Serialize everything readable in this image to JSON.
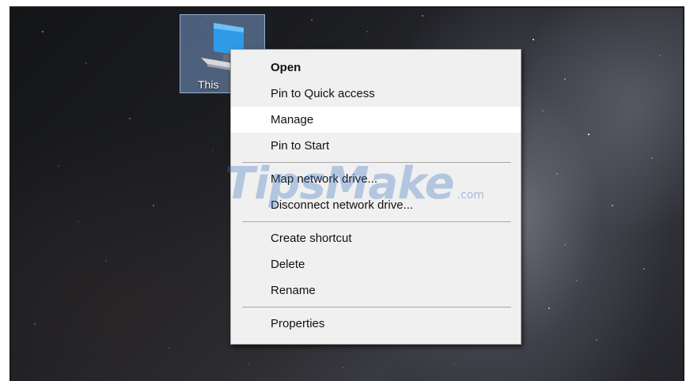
{
  "desktop_icon": {
    "label": "This",
    "icon": "monitor-icon"
  },
  "context_menu": {
    "items": [
      {
        "label": "Open",
        "bold": true
      },
      {
        "label": "Pin to Quick access"
      },
      {
        "label": "Manage",
        "highlighted": true
      },
      {
        "label": "Pin to Start"
      },
      {
        "label": "Map network drive..."
      },
      {
        "label": "Disconnect network drive..."
      },
      {
        "label": "Create shortcut"
      },
      {
        "label": "Delete"
      },
      {
        "label": "Rename"
      },
      {
        "label": "Properties"
      }
    ]
  },
  "watermark": {
    "text": "TipsMake",
    "suffix": ".com"
  },
  "colors": {
    "menu_background": "#f0f0f0",
    "menu_highlight": "#ffffff",
    "icon_selection": "#789bc8",
    "watermark": "#326ebe"
  }
}
